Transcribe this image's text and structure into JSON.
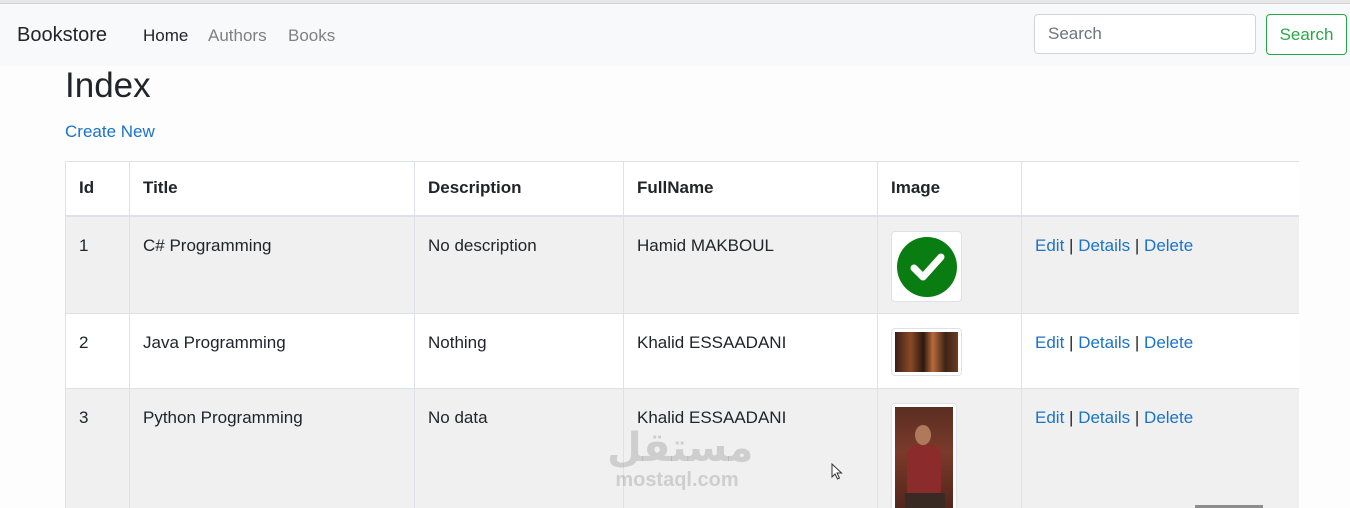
{
  "navbar": {
    "brand": "Bookstore",
    "links": [
      {
        "label": "Home",
        "active": true
      },
      {
        "label": "Authors",
        "active": false
      },
      {
        "label": "Books",
        "active": false
      }
    ],
    "search": {
      "placeholder": "Search",
      "value": "",
      "button_label": "Search",
      "button_color": "#28a745"
    }
  },
  "page": {
    "title": "Index",
    "create_link": "Create New",
    "link_color": "#1a73c8"
  },
  "table": {
    "headers": [
      "Id",
      "Title",
      "Description",
      "FullName",
      "Image",
      ""
    ],
    "rows": [
      {
        "id": "1",
        "title": "C# Programming",
        "description": "No description",
        "fullname": "Hamid MAKBOUL",
        "image": "green-checkmark-icon",
        "actions": {
          "edit": "Edit",
          "details": "Details",
          "delete": "Delete",
          "separator": "|"
        }
      },
      {
        "id": "2",
        "title": "Java Programming",
        "description": "Nothing",
        "fullname": "Khalid ESSAADANI",
        "image": "photo-thumbnail",
        "actions": {
          "edit": "Edit",
          "details": "Details",
          "delete": "Delete",
          "separator": "|"
        }
      },
      {
        "id": "3",
        "title": "Python Programming",
        "description": "No data",
        "fullname": "Khalid ESSAADANI",
        "image": "portrait-photo-thumbnail",
        "actions": {
          "edit": "Edit",
          "details": "Details",
          "delete": "Delete",
          "separator": "|"
        }
      }
    ]
  },
  "watermark": {
    "arabic": "مستقل",
    "latin": "mostaql.com"
  }
}
